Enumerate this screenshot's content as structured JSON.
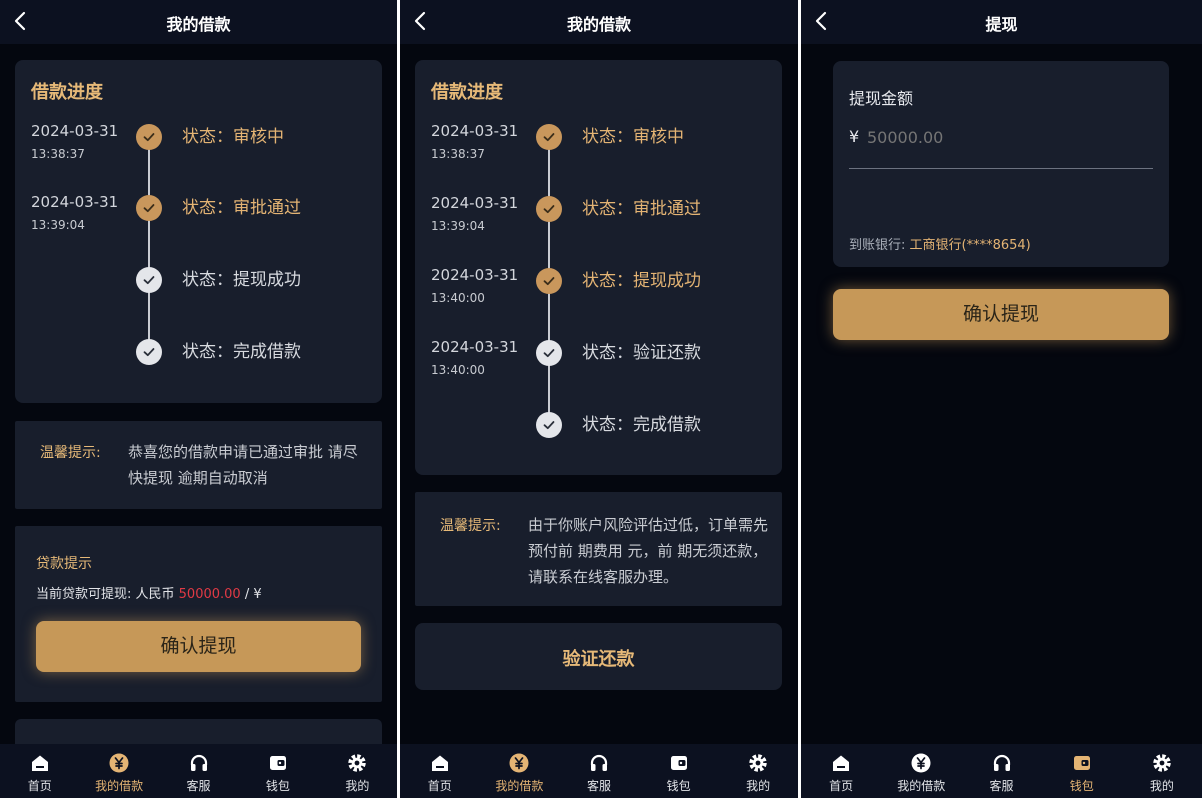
{
  "colors": {
    "accent": "#c69858",
    "accent_text": "#e4b474",
    "page_bg": "#04070f",
    "card_bg": "#181e2c",
    "highlight_red": "#e03a45"
  },
  "tabbar": {
    "items": [
      {
        "label": "首页",
        "icon": "home-icon"
      },
      {
        "label": "我的借款",
        "icon": "yuan-icon"
      },
      {
        "label": "客服",
        "icon": "headset-icon"
      },
      {
        "label": "钱包",
        "icon": "wallet-icon"
      },
      {
        "label": "我的",
        "icon": "gear-icon"
      }
    ]
  },
  "screen1": {
    "header_title": "我的借款",
    "progress_title": "借款进度",
    "timeline": [
      {
        "date": "2024-03-31",
        "time": "13:38:37",
        "status": "状态：审核中",
        "done": true
      },
      {
        "date": "2024-03-31",
        "time": "13:39:04",
        "status": "状态：审批通过",
        "done": true
      },
      {
        "date": "",
        "time": "",
        "status": "状态：提现成功",
        "done": false
      },
      {
        "date": "",
        "time": "",
        "status": "状态：完成借款",
        "done": false
      }
    ],
    "tip_label": "温馨提示:",
    "tip_text": "恭喜您的借款申请已通过审批 请尽快提现 逾期自动取消",
    "loan_notice_title": "贷款提示",
    "loan_available_prefix": "当前贷款可提现: 人民币",
    "loan_amount": "50000.00",
    "loan_suffix": "/ ¥",
    "confirm_button": "确认提现",
    "active_tab": 1
  },
  "screen2": {
    "header_title": "我的借款",
    "progress_title": "借款进度",
    "timeline": [
      {
        "date": "2024-03-31",
        "time": "13:38:37",
        "status": "状态：审核中",
        "done": true
      },
      {
        "date": "2024-03-31",
        "time": "13:39:04",
        "status": "状态：审批通过",
        "done": true
      },
      {
        "date": "2024-03-31",
        "time": "13:40:00",
        "status": "状态：提现成功",
        "done": true
      },
      {
        "date": "2024-03-31",
        "time": "13:40:00",
        "status": "状态：验证还款",
        "done": false
      },
      {
        "date": "",
        "time": "",
        "status": "状态：完成借款",
        "done": false
      }
    ],
    "tip_label": "温馨提示:",
    "tip_text": "由于你账户风险评估过低，订单需先预付前 期费用 元，前 期无须还款，请联系在线客服办理。",
    "verify_button": "验证还款",
    "active_tab": 1
  },
  "screen3": {
    "header_title": "提现",
    "amount_label": "提现金额",
    "currency_symbol": "¥",
    "amount_placeholder": "50000.00",
    "bank_label": "到账银行:",
    "bank_value": "工商银行(****8654)",
    "confirm_button": "确认提现",
    "active_tab": 3
  }
}
